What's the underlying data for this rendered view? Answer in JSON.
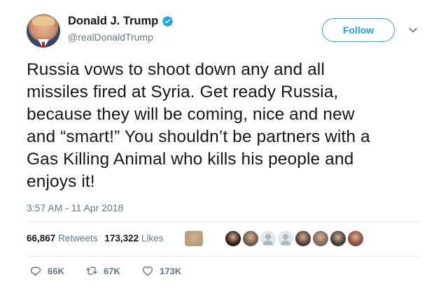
{
  "user": {
    "display_name": "Donald J. Trump",
    "handle": "@realDonaldTrump",
    "verified": true
  },
  "follow_button": {
    "label": "Follow"
  },
  "tweet": {
    "lines": [
      "Russia vows to shoot down any and all",
      "missiles fired at Syria. Get ready Russia,",
      "because they will be coming, nice and new",
      "and “smart!” You shouldn’t be partners with a",
      "Gas Killing Animal who kills his people and",
      "enjoys it!"
    ],
    "timestamp": "3:57 AM - 11 Apr 2018"
  },
  "stats": {
    "retweets_count": "66,867",
    "retweets_label": "Retweets",
    "likes_count": "173,322",
    "likes_label": "Likes"
  },
  "likers": [
    {
      "icon": "avatar",
      "color": "#b8a07a"
    },
    {
      "icon": "avatar",
      "color": "#2b1a1a"
    },
    {
      "icon": "avatar",
      "color": "#6b5a4a"
    },
    {
      "icon": "default-avatar",
      "color": "#aab8c2"
    },
    {
      "icon": "default-avatar",
      "color": "#aab8c2"
    },
    {
      "icon": "avatar",
      "color": "#4a3a36"
    },
    {
      "icon": "avatar",
      "color": "#7a6a5e"
    },
    {
      "icon": "avatar",
      "color": "#3a3a3a"
    },
    {
      "icon": "avatar",
      "color": "#8a4a3a"
    }
  ],
  "actions": {
    "replies": "66K",
    "retweets": "67K",
    "likes": "173K"
  },
  "colors": {
    "accent": "#1da1f2",
    "secondary_text": "#657786",
    "primary_text": "#14171a",
    "divider": "#e6ecf0"
  }
}
